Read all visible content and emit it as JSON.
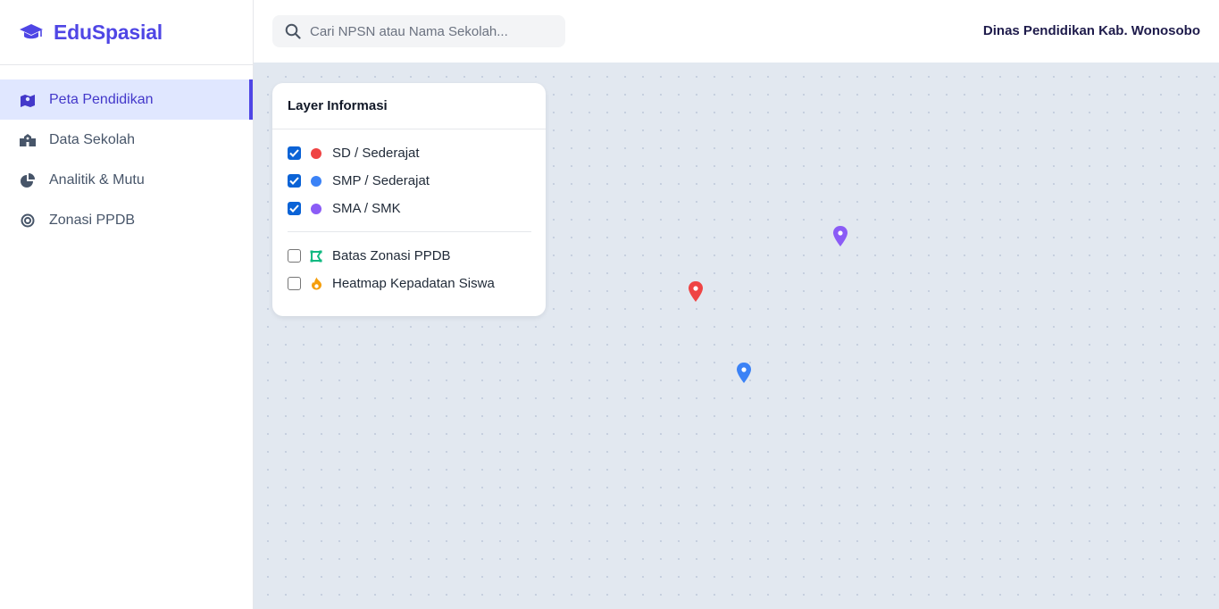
{
  "app": {
    "name": "EduSpasial",
    "brand_color": "#4f46e5"
  },
  "sidebar": {
    "items": [
      {
        "label": "Peta Pendidikan",
        "icon": "map-icon",
        "active": true
      },
      {
        "label": "Data Sekolah",
        "icon": "school-icon",
        "active": false
      },
      {
        "label": "Analitik & Mutu",
        "icon": "pie-chart-icon",
        "active": false
      },
      {
        "label": "Zonasi PPDB",
        "icon": "target-icon",
        "active": false
      }
    ]
  },
  "header": {
    "search_placeholder": "Cari NPSN atau Nama Sekolah...",
    "organization": "Dinas Pendidikan Kab. Wonosobo"
  },
  "layer_panel": {
    "title": "Layer Informasi",
    "school_layers": [
      {
        "label": "SD / Sederajat",
        "checked": true,
        "color": "#ef4444"
      },
      {
        "label": "SMP / Sederajat",
        "checked": true,
        "color": "#3b82f6"
      },
      {
        "label": "SMA / SMK",
        "checked": true,
        "color": "#8b5cf6"
      }
    ],
    "overlay_layers": [
      {
        "label": "Batas Zonasi PPDB",
        "checked": false,
        "icon": "draw-polygon-icon",
        "color": "#10b981"
      },
      {
        "label": "Heatmap Kepadatan Siswa",
        "checked": false,
        "icon": "fire-icon",
        "color": "#f59e0b"
      }
    ]
  },
  "map": {
    "markers": [
      {
        "type": "SMA / SMK",
        "color": "#8b5cf6"
      },
      {
        "type": "SD / Sederajat",
        "color": "#ef4444"
      },
      {
        "type": "SMP / Sederajat",
        "color": "#3b82f6"
      }
    ]
  }
}
